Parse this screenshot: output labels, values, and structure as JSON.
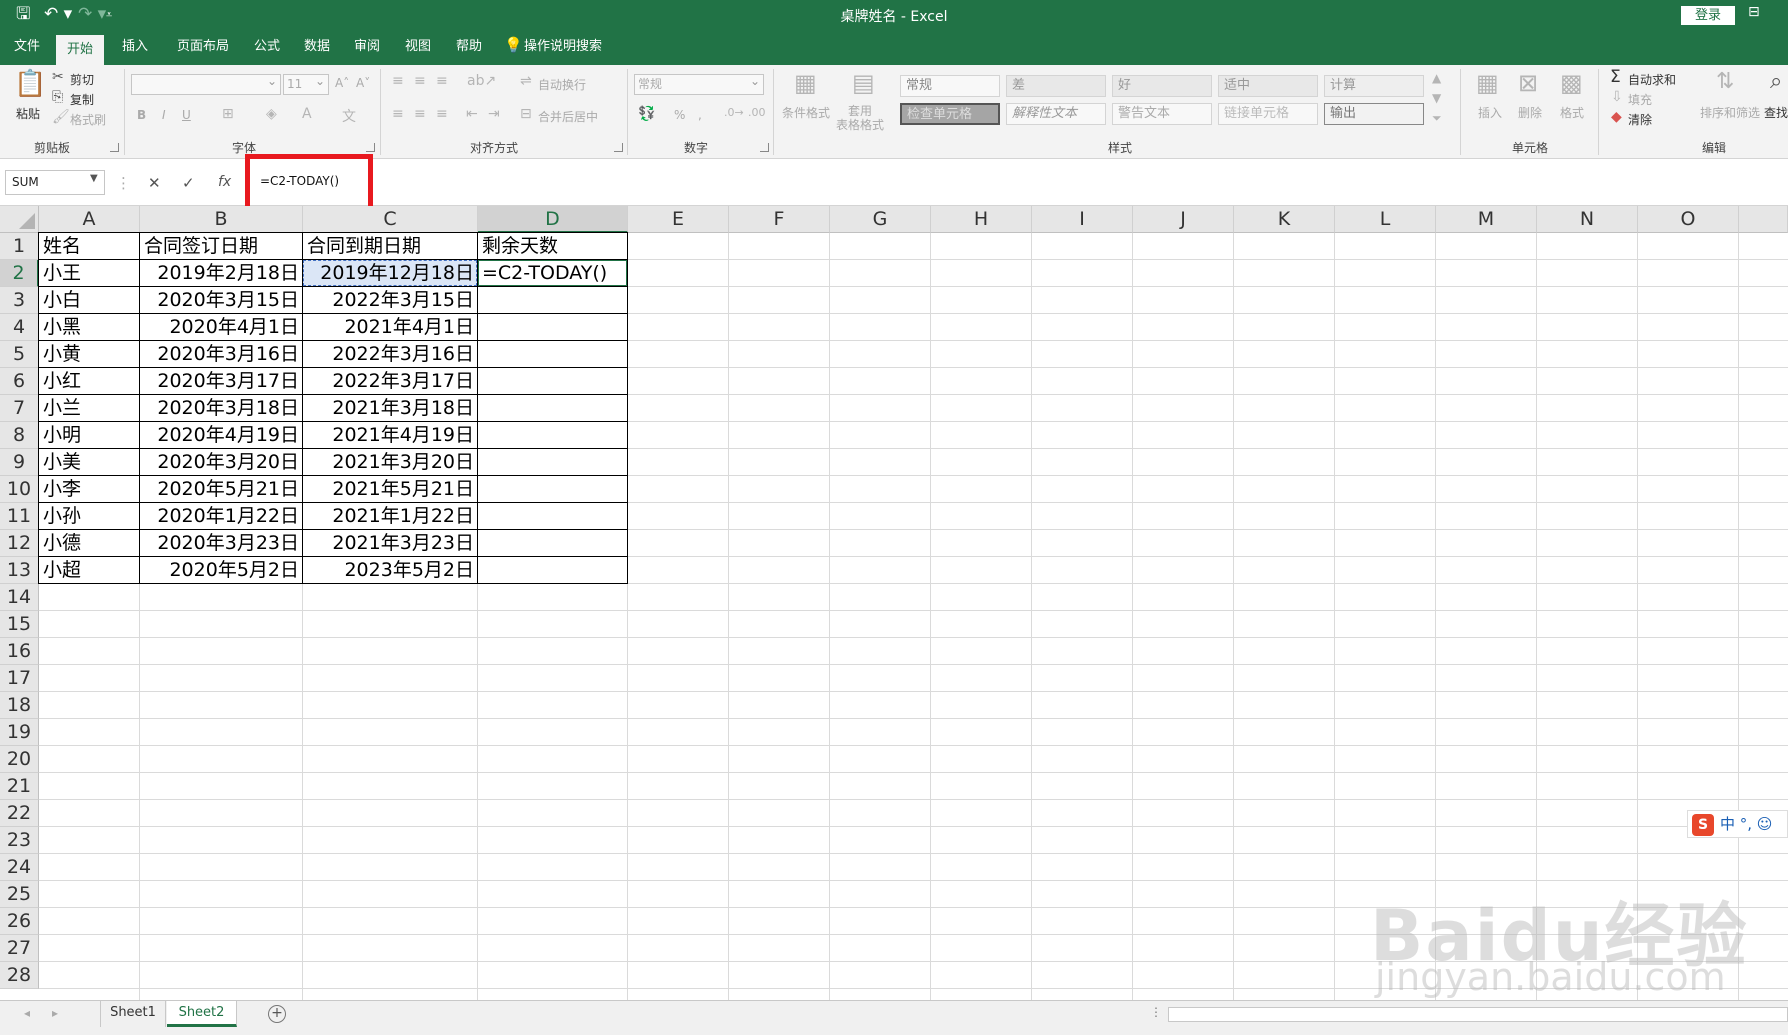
{
  "title_bar": {
    "doc_title": "桌牌姓名  -  Excel",
    "login_label": "登录",
    "icons": [
      "save-icon",
      "undo-icon",
      "redo-icon",
      "customize-qat-icon",
      "ribbon-display-icon"
    ]
  },
  "tabs": [
    "文件",
    "开始",
    "插入",
    "页面布局",
    "公式",
    "数据",
    "审阅",
    "视图",
    "帮助",
    "操作说明搜索"
  ],
  "active_tab": "开始",
  "ribbon": {
    "clipboard": {
      "paste": "粘贴",
      "cut": "剪切",
      "copy": "复制",
      "format_painter": "格式刷",
      "label": "剪贴板"
    },
    "font": {
      "size": "11",
      "bold": "B",
      "italic": "I",
      "underline": "U",
      "grow": "A˄",
      "shrink": "A˅",
      "label": "字体"
    },
    "alignment": {
      "wrap": "自动换行",
      "merge": "合并后居中",
      "label": "对齐方式"
    },
    "number": {
      "format": "常规",
      "percent": "%",
      "comma": ",",
      "label": "数字"
    },
    "styles": {
      "conditional": "条件格式",
      "table_format": "套用\n表格格式",
      "cells": [
        "常规",
        "差",
        "好",
        "适中",
        "计算",
        "检查单元格",
        "解释性文本",
        "警告文本",
        "链接单元格",
        "输出"
      ],
      "label": "样式"
    },
    "cells": {
      "insert": "插入",
      "delete": "删除",
      "format": "格式",
      "label": "单元格"
    },
    "editing": {
      "autosum": "自动求和",
      "fill": "填充",
      "clear": "清除",
      "sort": "排序和筛选",
      "find": "查找",
      "label": "编辑"
    }
  },
  "formula_bar": {
    "name_box": "SUM",
    "formula": "=C2-TODAY()",
    "fx": "fx"
  },
  "columns": [
    "A",
    "B",
    "C",
    "D",
    "E",
    "F",
    "G",
    "H",
    "I",
    "J",
    "K",
    "L",
    "M",
    "N",
    "O"
  ],
  "rows": [
    "1",
    "2",
    "3",
    "4",
    "5",
    "6",
    "7",
    "8",
    "9",
    "10",
    "11",
    "12",
    "13",
    "14",
    "15",
    "16",
    "17",
    "18",
    "19",
    "20",
    "21",
    "22",
    "23",
    "24",
    "25",
    "26",
    "27",
    "28"
  ],
  "table": {
    "headers": [
      "姓名",
      "合同签订日期",
      "合同到期日期",
      "剩余天数"
    ],
    "rows": [
      [
        "小王",
        "2019年2月18日",
        "2019年12月18日",
        "=C2-TODAY()"
      ],
      [
        "小白",
        "2020年3月15日",
        "2022年3月15日",
        ""
      ],
      [
        "小黑",
        "2020年4月1日",
        "2021年4月1日",
        ""
      ],
      [
        "小黄",
        "2020年3月16日",
        "2022年3月16日",
        ""
      ],
      [
        "小红",
        "2020年3月17日",
        "2022年3月17日",
        ""
      ],
      [
        "小兰",
        "2020年3月18日",
        "2021年3月18日",
        ""
      ],
      [
        "小明",
        "2020年4月19日",
        "2021年4月19日",
        ""
      ],
      [
        "小美",
        "2020年3月20日",
        "2021年3月20日",
        ""
      ],
      [
        "小李",
        "2020年5月21日",
        "2021年5月21日",
        ""
      ],
      [
        "小孙",
        "2020年1月22日",
        "2021年1月22日",
        ""
      ],
      [
        "小德",
        "2020年3月23日",
        "2021年3月23日",
        ""
      ],
      [
        "小超",
        "2020年5月2日",
        "2023年5月2日",
        ""
      ]
    ]
  },
  "sheets": [
    "Sheet1",
    "Sheet2"
  ],
  "active_sheet": "Sheet2",
  "ime": {
    "logo": "S",
    "text": "中 °, ☺"
  },
  "watermark": {
    "brand": "Baidu经验",
    "url": "jingyan.baidu.com"
  },
  "colors": {
    "excel_green": "#217346",
    "highlight_red": "#e8191f"
  }
}
